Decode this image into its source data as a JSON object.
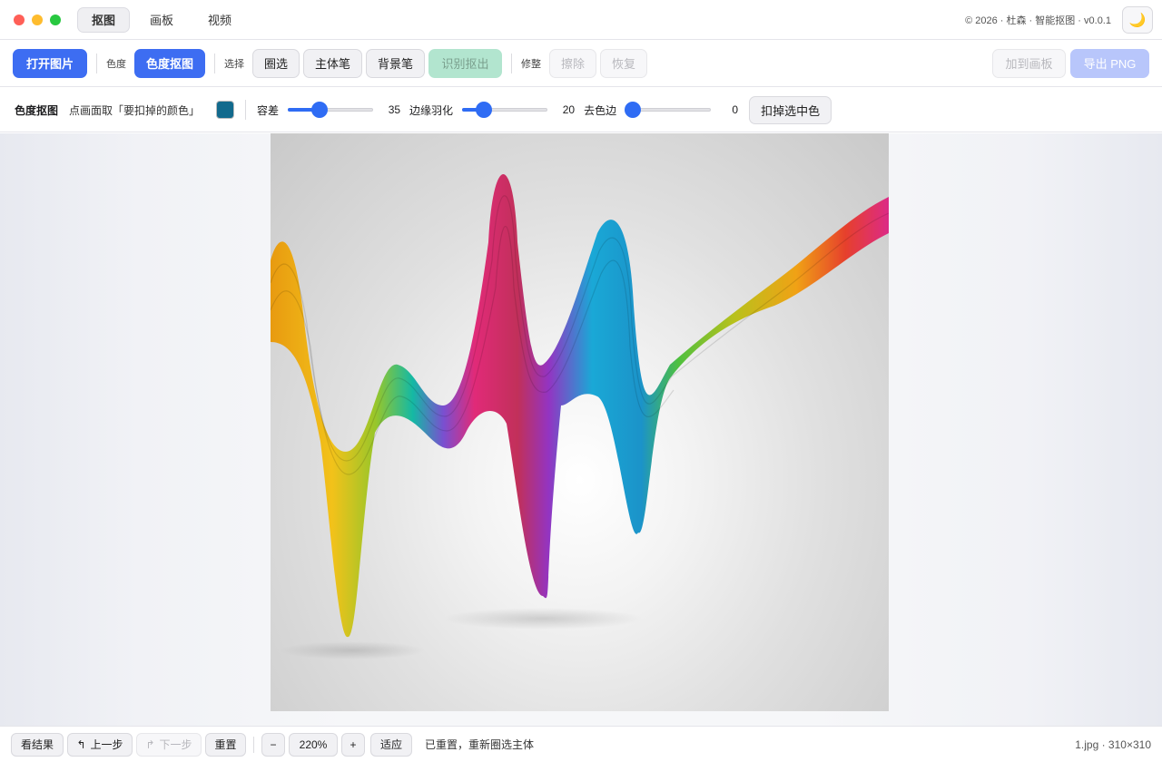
{
  "titlebar": {
    "tabs": [
      {
        "label": "抠图",
        "active": true
      },
      {
        "label": "画板",
        "active": false
      },
      {
        "label": "视频",
        "active": false
      }
    ],
    "copyright": "© 2026 · 杜森 · 智能抠图 · v0.0.1",
    "theme_icon": "moon-icon",
    "traffic_colors": [
      "#ff5f57",
      "#febc2e",
      "#28c840"
    ]
  },
  "toolbar": {
    "open_label": "打开图片",
    "color_group_label": "色度",
    "color_key_label": "色度抠图",
    "select_group_label": "选择",
    "lasso_label": "圈选",
    "subject_brush_label": "主体笔",
    "background_brush_label": "背景笔",
    "detect_label": "识别抠出",
    "refine_group_label": "修整",
    "erase_label": "擦除",
    "restore_label": "恢复",
    "add_to_board_label": "加到画板",
    "export_label": "导出 PNG"
  },
  "options": {
    "title": "色度抠图",
    "hint": "点画面取「要扣掉的颜色」",
    "picked_color": "#126a8d",
    "tolerance_label": "容差",
    "tolerance_value": 35,
    "tolerance_max": 100,
    "feather_label": "边缘羽化",
    "feather_value": 20,
    "feather_max": 100,
    "defringe_label": "去色边",
    "defringe_value": 0,
    "defringe_max": 100,
    "apply_label": "扣掉选中色"
  },
  "statusbar": {
    "view_result_label": "看结果",
    "undo_label": "上一步",
    "redo_label": "下一步",
    "reset_label": "重置",
    "zoom_out_label": "−",
    "zoom_value": "220%",
    "zoom_in_label": "+",
    "fit_label": "适应",
    "message": "已重置，重新圈选主体",
    "file_info": "1.jpg · 310×310"
  }
}
